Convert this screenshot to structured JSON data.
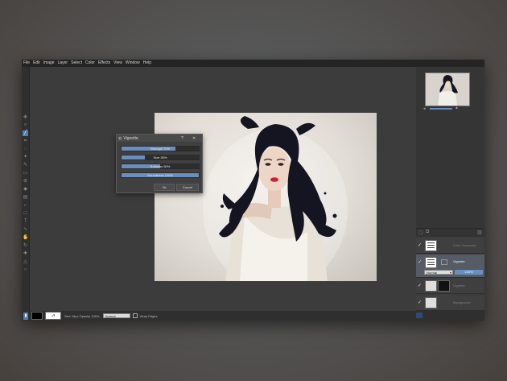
{
  "menu": [
    "File",
    "Edit",
    "Image",
    "Layer",
    "Select",
    "Color",
    "Effects",
    "View",
    "Window",
    "Help"
  ],
  "tools": [
    "move-icon",
    "zoom-icon",
    "brush-icon",
    "crop-icon",
    "lasso-icon",
    "magic-wand-icon",
    "pencil-icon",
    "eraser-icon",
    "clone-icon",
    "fill-icon",
    "gradient-icon",
    "dropper-icon",
    "shape-icon",
    "text-icon",
    "smudge-icon",
    "hand-icon",
    "rotate-icon",
    "heal-icon",
    "sharpen-icon",
    "blur-icon"
  ],
  "dialog": {
    "title": "Vignette",
    "help": "?",
    "close": "✕",
    "sliders": [
      {
        "label": "Strength 70%",
        "value": 0.7
      },
      {
        "label": "Size 30%",
        "value": 0.3
      },
      {
        "label": "Softness 50%",
        "value": 0.5
      },
      {
        "label": "Roundness 100%",
        "value": 1.0
      }
    ],
    "ok": "Ok",
    "cancel": "Cancel"
  },
  "layers": [
    {
      "name": "Color Correction",
      "visible": "✓",
      "selected": false
    },
    {
      "name": "Vignette",
      "visible": "✓",
      "selected": true
    },
    {
      "name": "Vignette",
      "visible": "✓",
      "selected": false
    },
    {
      "name": "Background",
      "visible": "✓",
      "selected": false
    }
  ],
  "layer_blend": "Normal",
  "layer_opacity": "100%",
  "status": {
    "size_label": "Size 15px Opacity 100%",
    "mode": "Normal",
    "wrap": "Wrap Edges"
  }
}
